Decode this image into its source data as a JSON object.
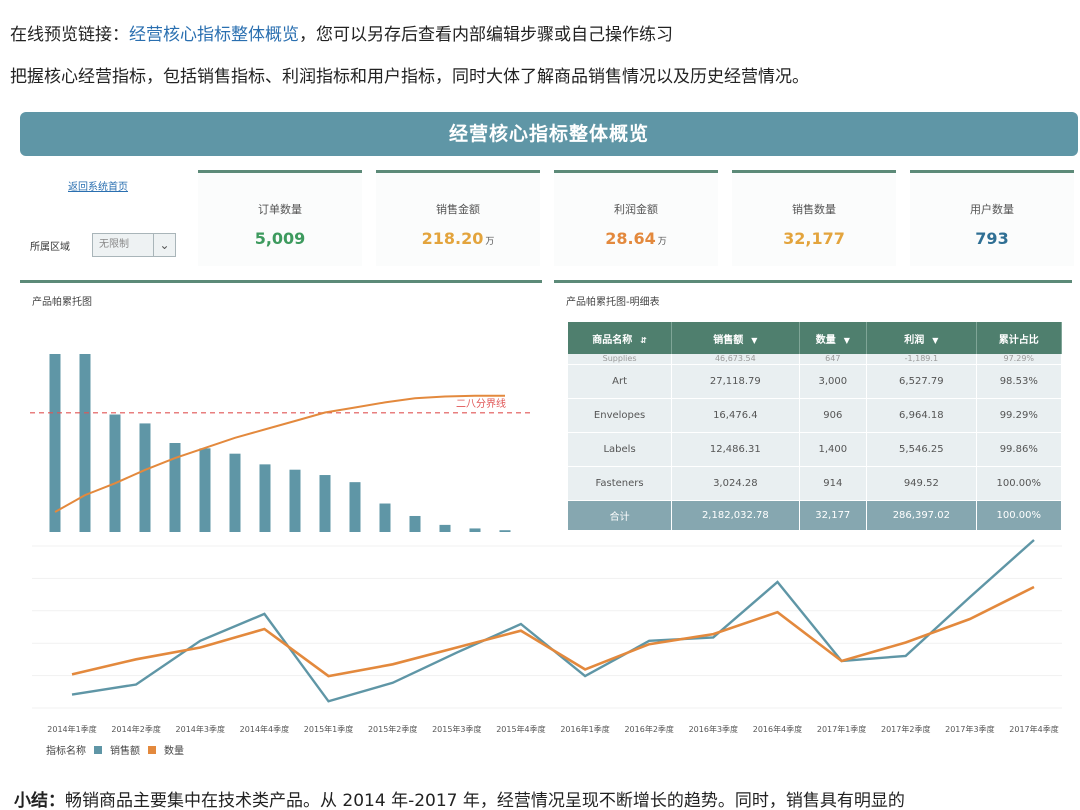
{
  "intro": {
    "line1_prefix": "在线预览链接：",
    "line1_link": "经营核心指标整体概览",
    "line1_suffix": "，您可以另存后查看内部编辑步骤或自己操作练习",
    "line2": "把握核心经营指标，包括销售指标、利润指标和用户指标，同时大体了解商品销售情况以及历史经营情况。"
  },
  "dashboard": {
    "title": "经营核心指标整体概览",
    "back_link": "返回系统首页",
    "region_label": "所属区域",
    "region_value": "无限制",
    "colors": {
      "header": "#5f96a6",
      "accent_green": "#5c8a78",
      "bar": "#5f96a6",
      "orange": "#e3893d",
      "red_line": "#e05555"
    },
    "kpis": [
      {
        "label": "订单数量",
        "value": "5,009",
        "unit": "",
        "color": "#3d9a5e"
      },
      {
        "label": "销售金额",
        "value": "218.20",
        "unit": "万",
        "color": "#e3a43d"
      },
      {
        "label": "利润金额",
        "value": "28.64",
        "unit": "万",
        "color": "#e3893d"
      },
      {
        "label": "销售数量",
        "value": "32,177",
        "unit": "",
        "color": "#e3a43d"
      },
      {
        "label": "用户数量",
        "value": "793",
        "unit": "",
        "color": "#2f6f94"
      }
    ],
    "pareto": {
      "title": "产品帕累托图",
      "threshold_label": "二八分界线",
      "bar_values": [
        100,
        100,
        66,
        61,
        50,
        47,
        44,
        38,
        35,
        32,
        28,
        16,
        9,
        4,
        2,
        1
      ],
      "cumulative": [
        0.2,
        0.3,
        0.37,
        0.45,
        0.52,
        0.58,
        0.64,
        0.69,
        0.74,
        0.79,
        0.82,
        0.85,
        0.875,
        0.885,
        0.89,
        0.89
      ],
      "threshold": 0.8
    },
    "table": {
      "title": "产品帕累托图-明细表",
      "headers": [
        "商品名称",
        "销售额",
        "数量",
        "利润",
        "累计占比"
      ],
      "partial_row": [
        "Supplies",
        "46,673.54",
        "647",
        "-1,189.1",
        "97.29%"
      ],
      "rows": [
        [
          "Art",
          "27,118.79",
          "3,000",
          "6,527.79",
          "98.53%"
        ],
        [
          "Envelopes",
          "16,476.4",
          "906",
          "6,964.18",
          "99.29%"
        ],
        [
          "Labels",
          "12,486.31",
          "1,400",
          "5,546.25",
          "99.86%"
        ],
        [
          "Fasteners",
          "3,024.28",
          "914",
          "949.52",
          "100.00%"
        ]
      ],
      "total": [
        "合计",
        "2,182,032.78",
        "32,177",
        "286,397.02",
        "100.00%"
      ]
    }
  },
  "chart_data": {
    "type": "line",
    "categories": [
      "2014年1季度",
      "2014年2季度",
      "2014年3季度",
      "2014年4季度",
      "2015年1季度",
      "2015年2季度",
      "2015年3季度",
      "2015年4季度",
      "2016年1季度",
      "2016年2季度",
      "2016年3季度",
      "2016年4季度",
      "2017年1季度",
      "2017年2季度",
      "2017年3季度",
      "2017年4季度"
    ],
    "series": [
      {
        "name": "销售额",
        "color": "#5f96a6",
        "values": [
          0.08,
          0.14,
          0.4,
          0.56,
          0.04,
          0.15,
          0.33,
          0.5,
          0.19,
          0.4,
          0.42,
          0.75,
          0.28,
          0.31,
          0.66,
          1.0
        ]
      },
      {
        "name": "数量",
        "color": "#e3893d",
        "values": [
          0.2,
          0.29,
          0.36,
          0.47,
          0.19,
          0.26,
          0.36,
          0.46,
          0.23,
          0.38,
          0.44,
          0.57,
          0.28,
          0.39,
          0.53,
          0.72
        ]
      }
    ],
    "legend_title": "指标名称",
    "legend_position": "bottom-left",
    "grid": true
  },
  "summary": {
    "label": "小结：",
    "text": "畅销商品主要集中在技术类产品。从 2014 年-2017 年，经营情况呈现不断增长的趋势。同时，销售具有明显的"
  }
}
